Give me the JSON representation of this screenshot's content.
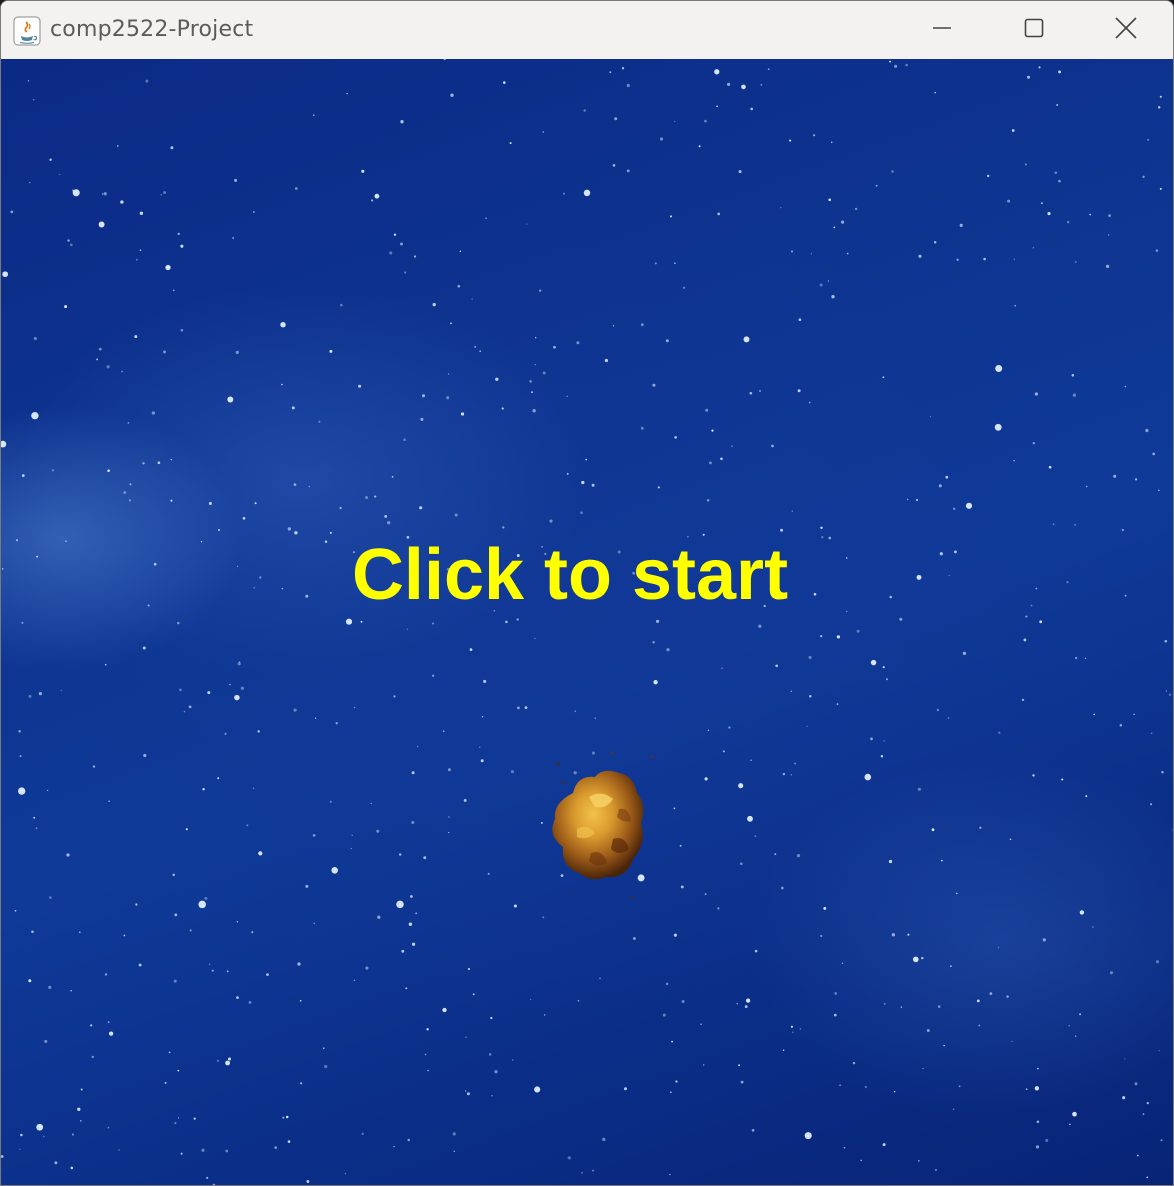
{
  "window": {
    "title": "comp2522-Project",
    "icon": "java-icon",
    "controls": {
      "minimize_icon": "minimize-icon",
      "maximize_icon": "maximize-icon",
      "close_icon": "close-icon"
    }
  },
  "game": {
    "background": "starfield",
    "prompt": "Click to start",
    "prompt_color": "#ffff00",
    "sprite": "asteroid"
  }
}
